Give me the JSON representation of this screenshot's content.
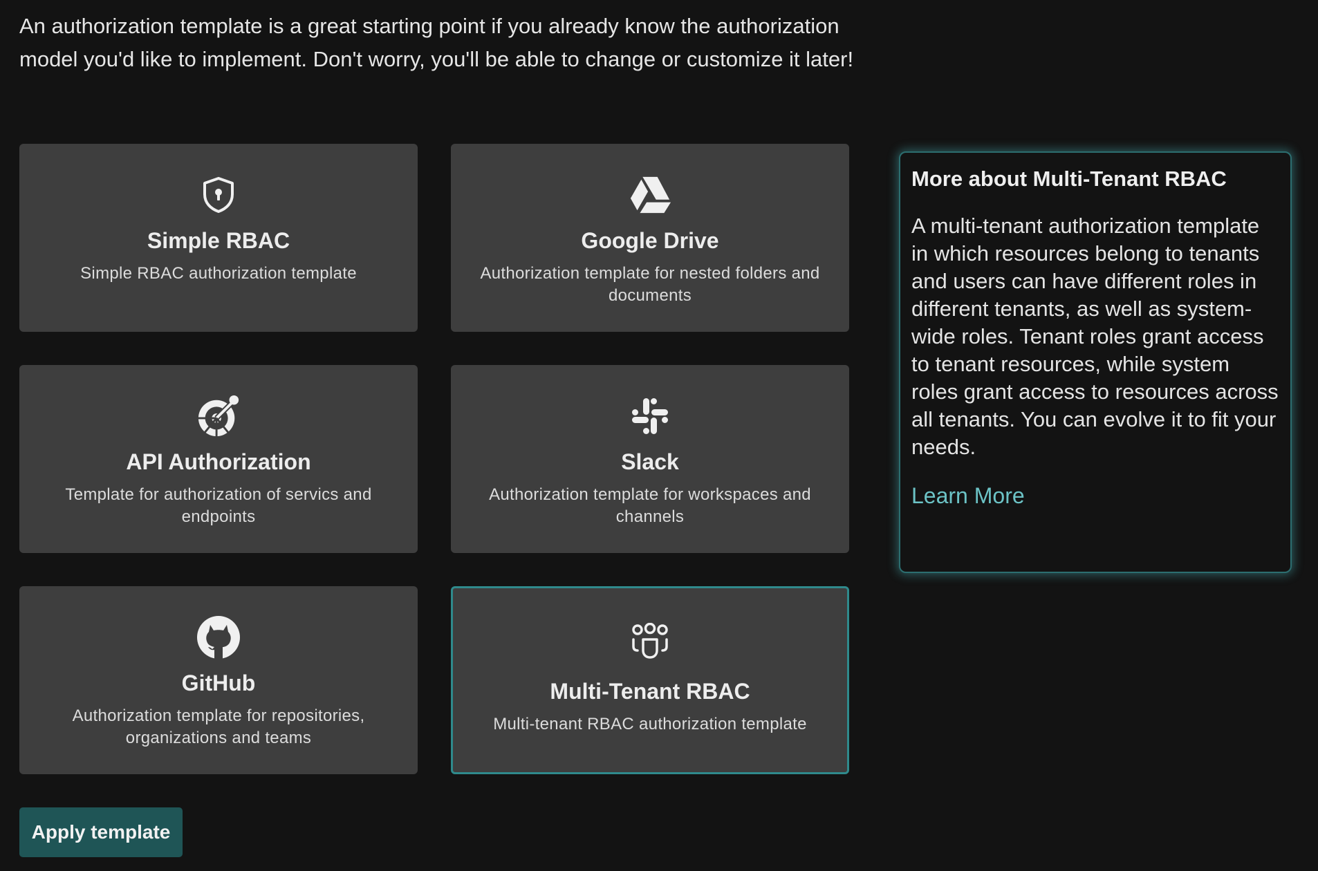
{
  "intro_text": "An authorization template is a great starting point if you already know the authorization model you'd like to implement. Don't worry, you'll be able to change or customize it later!",
  "templates": [
    {
      "title": "Simple RBAC",
      "description": "Simple RBAC authorization template",
      "icon": "shield-lock-icon",
      "selected": false
    },
    {
      "title": "Google Drive",
      "description": "Authorization template for nested folders and documents",
      "icon": "google-drive-icon",
      "selected": false
    },
    {
      "title": "API Authorization",
      "description": "Template for authorization of servics and endpoints",
      "icon": "api-gauge-icon",
      "selected": false
    },
    {
      "title": "Slack",
      "description": "Authorization template for workspaces and channels",
      "icon": "slack-icon",
      "selected": false
    },
    {
      "title": "GitHub",
      "description": "Authorization template for repositories, organizations and teams",
      "icon": "github-icon",
      "selected": false
    },
    {
      "title": "Multi-Tenant RBAC",
      "description": "Multi-tenant RBAC authorization template",
      "icon": "multi-user-icon",
      "selected": true
    }
  ],
  "info_panel": {
    "title": "More about Multi-Tenant RBAC",
    "body": "A multi-tenant authorization template in which resources belong to tenants and users can have different roles in different tenants, as well as system-wide roles. Tenant roles grant access to tenant resources, while system roles grant access to resources across all tenants. You can evolve it to fit your needs.",
    "link_label": "Learn More"
  },
  "apply_button_label": "Apply template",
  "colors": {
    "background": "#131313",
    "card": "#3e3e3e",
    "selected_border": "#2f8a8c",
    "link": "#6cc3c6",
    "button": "#1f5556"
  }
}
